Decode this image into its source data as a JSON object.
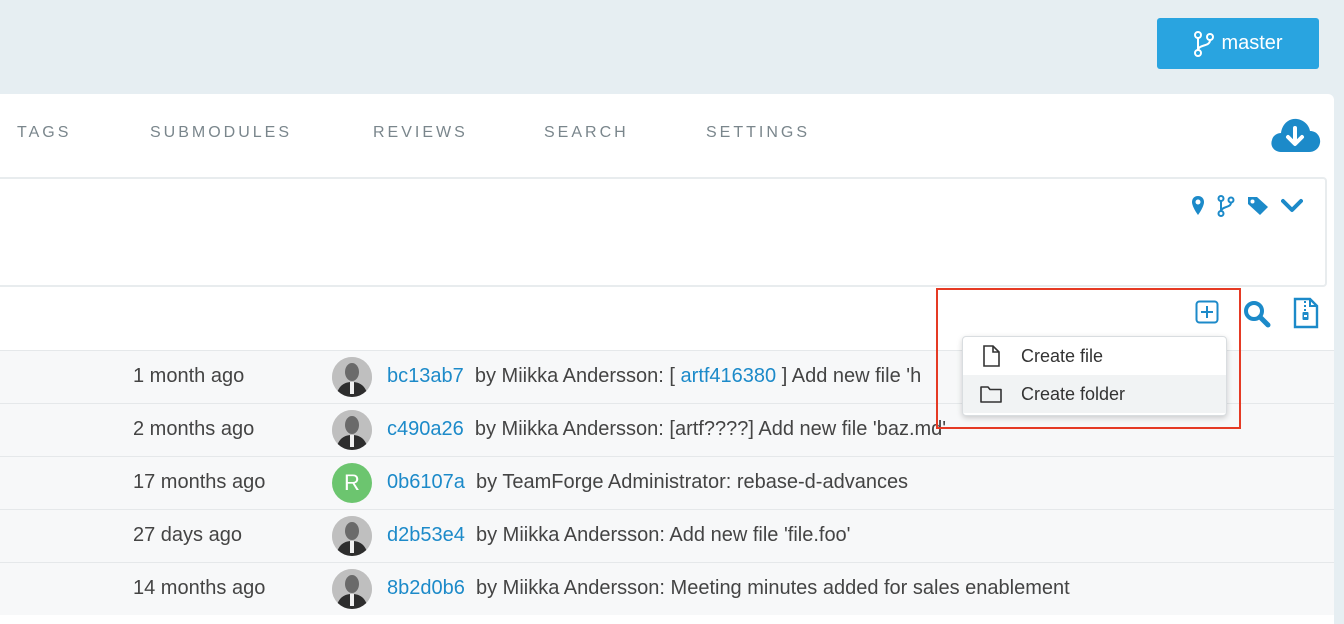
{
  "branch_button": {
    "label": "master",
    "color": "#29a4e0"
  },
  "tabs": [
    {
      "label": "TAGS"
    },
    {
      "label": "SUBMODULES"
    },
    {
      "label": "REVIEWS"
    },
    {
      "label": "SEARCH"
    },
    {
      "label": "SETTINGS"
    }
  ],
  "icons": {
    "download": "cloud-download-icon",
    "ref_selectors": [
      "map-marker-icon",
      "branch-icon",
      "tag-icon",
      "chevron-down-icon"
    ],
    "toolbar": [
      "add-icon",
      "search-icon",
      "zip-file-icon"
    ]
  },
  "create_menu": {
    "items": [
      {
        "label": "Create file",
        "icon": "file-icon"
      },
      {
        "label": "Create folder",
        "icon": "folder-icon"
      }
    ]
  },
  "commits": [
    {
      "time": "1 month ago",
      "hash": "bc13ab7",
      "author_prefix": "by Miikka Andersson: [ ",
      "artf": "artf416380",
      "message": " ] Add new file 'h",
      "avatar": "photo"
    },
    {
      "time": "2 months ago",
      "hash": "c490a26",
      "author_prefix": "by Miikka Andersson: [artf????] Add new file 'baz.md'",
      "artf": "",
      "message": "",
      "avatar": "photo"
    },
    {
      "time": "17 months ago",
      "hash": "0b6107a",
      "author_prefix": "by TeamForge Administrator: rebase-d-advances",
      "artf": "",
      "message": "",
      "avatar": "R"
    },
    {
      "time": "27 days ago",
      "hash": "d2b53e4",
      "author_prefix": "by Miikka Andersson: Add new file 'file.foo'",
      "artf": "",
      "message": "",
      "avatar": "photo"
    },
    {
      "time": "14 months ago",
      "hash": "8b2d0b6",
      "author_prefix": "by Miikka Andersson: Meeting minutes added for sales enablement",
      "artf": "",
      "message": "",
      "avatar": "photo"
    }
  ],
  "colors": {
    "accent": "#1c8ac9",
    "highlight": "#e53a24",
    "avatar_letter_bg": "#6cc56f"
  }
}
